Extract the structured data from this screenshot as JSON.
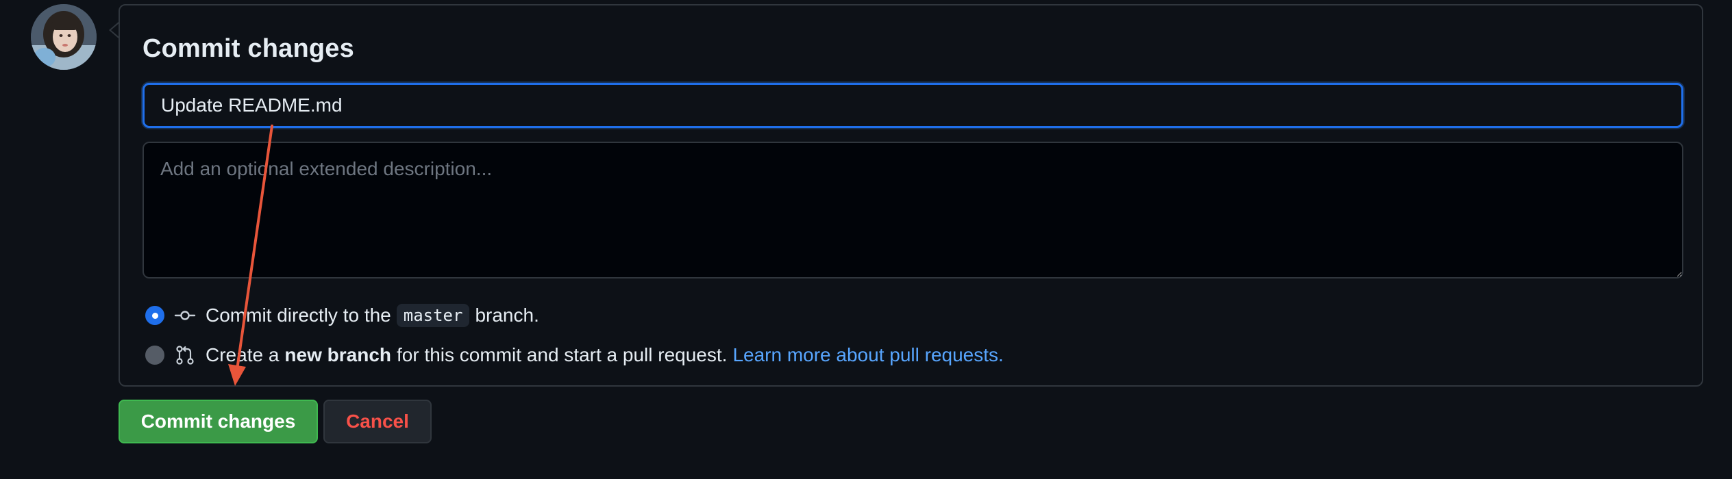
{
  "panel": {
    "title": "Commit changes",
    "summary_value": "Update README.md",
    "description_placeholder": "Add an optional extended description..."
  },
  "options": {
    "direct": {
      "prefix": "Commit directly to the",
      "branch": "master",
      "suffix": "branch.",
      "selected": true
    },
    "new_branch": {
      "prefix": "Create a",
      "bold": "new branch",
      "suffix": "for this commit and start a pull request.",
      "link": "Learn more about pull requests.",
      "selected": false
    }
  },
  "buttons": {
    "commit_label": "Commit changes",
    "cancel_label": "Cancel"
  },
  "icons": {
    "commit": "git-commit-icon",
    "pull_request": "git-pull-request-icon"
  },
  "colors": {
    "background": "#0d1117",
    "focus_border": "#1f6feb",
    "primary_button": "#3b9a47",
    "danger_text": "#f85149",
    "link": "#58a6ff",
    "annotation_arrow": "#e8553a"
  }
}
